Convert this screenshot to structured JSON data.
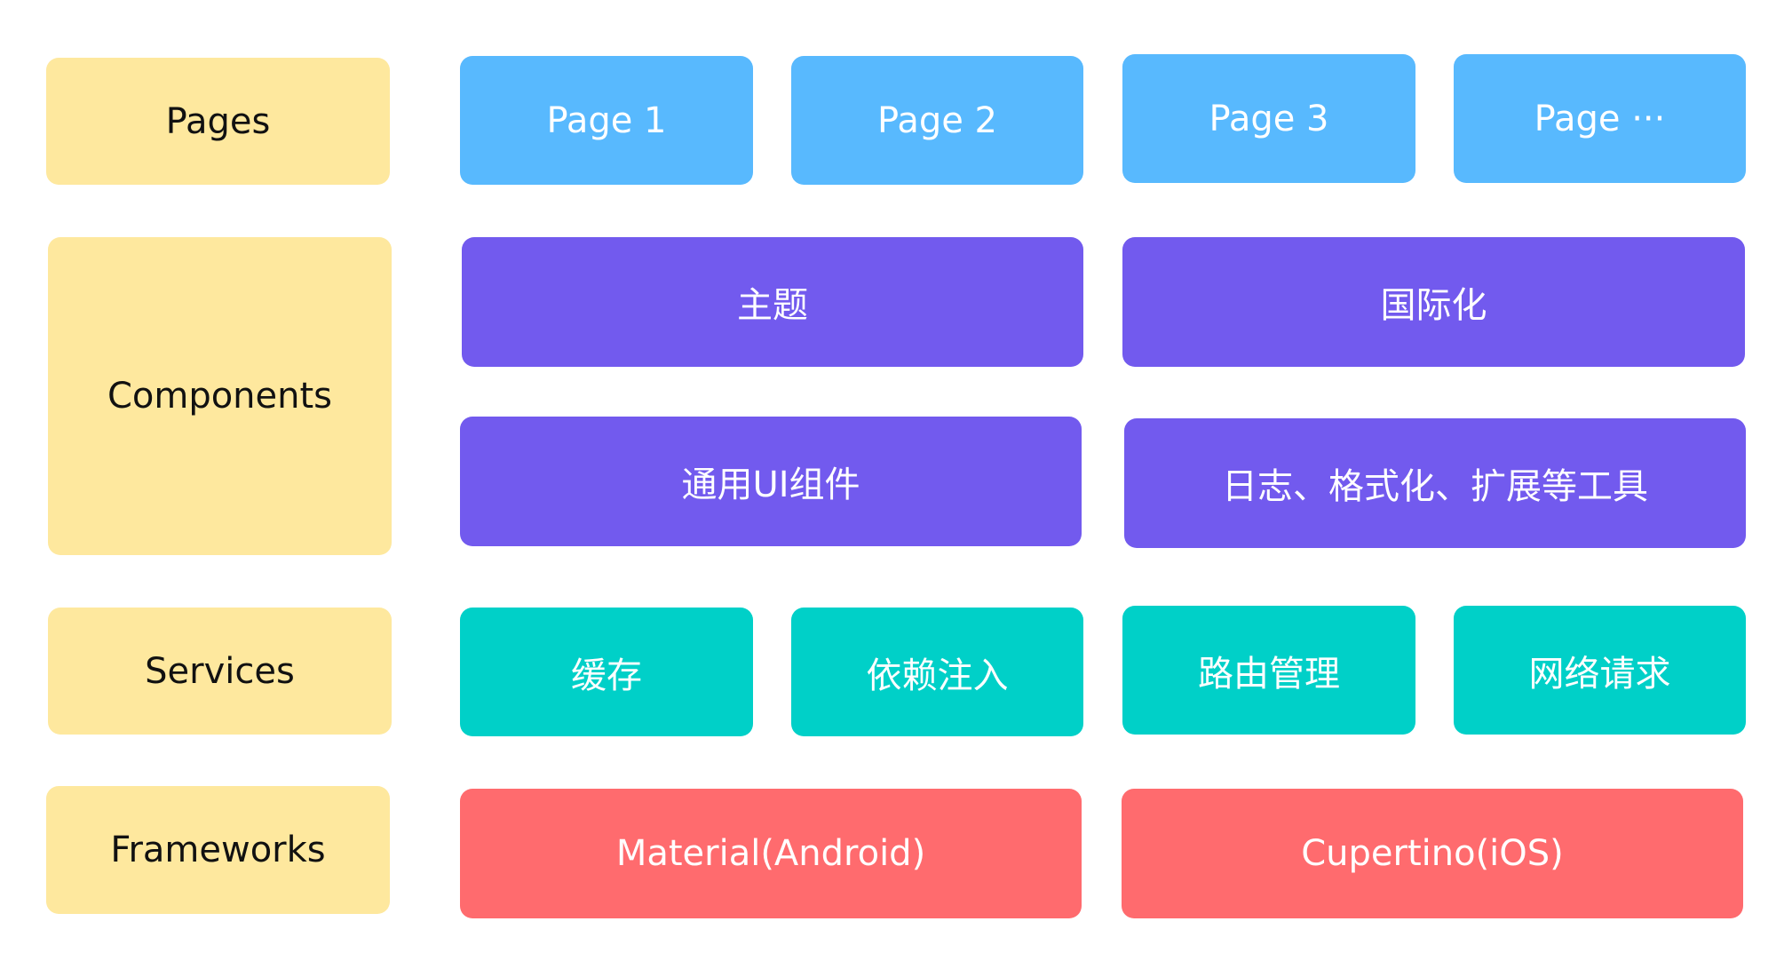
{
  "layers": {
    "pages": {
      "label": "Pages",
      "items": [
        "Page 1",
        "Page 2",
        "Page 3",
        "Page ···"
      ]
    },
    "components": {
      "label": "Components",
      "items": [
        "主题",
        "国际化",
        "通用UI组件",
        "日志、格式化、扩展等工具"
      ]
    },
    "services": {
      "label": "Services",
      "items": [
        "缓存",
        "依赖注入",
        "路由管理",
        "网络请求"
      ]
    },
    "frameworks": {
      "label": "Frameworks",
      "items": [
        "Material(Android)",
        "Cupertino(iOS)"
      ]
    }
  },
  "colors": {
    "label": "#FEE89E",
    "pages": "#58B9FE",
    "components": "#725AEE",
    "services": "#00D0C8",
    "frameworks": "#FF6B6E"
  }
}
